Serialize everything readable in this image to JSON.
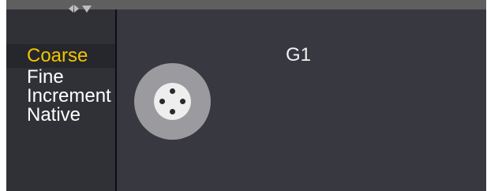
{
  "spinner": {
    "left_icon": "arrow-left-icon",
    "right_icon": "arrow-right-icon",
    "dropdown_icon": "arrow-down-icon"
  },
  "list": {
    "items": [
      {
        "label": "Coarse",
        "selected": true
      },
      {
        "label": "Fine",
        "selected": false
      },
      {
        "label": "Increment",
        "selected": false
      },
      {
        "label": "Native",
        "selected": false
      }
    ]
  },
  "fixture": {
    "label": "G1",
    "icon": "gobo-wheel-icon"
  },
  "colors": {
    "panel_bg": "#373840",
    "list_bg": "#303037",
    "selected_text": "#f2c400",
    "text": "#ffffff",
    "dial_outer": "#9a9a9f",
    "dial_inner": "#eeeeee"
  }
}
